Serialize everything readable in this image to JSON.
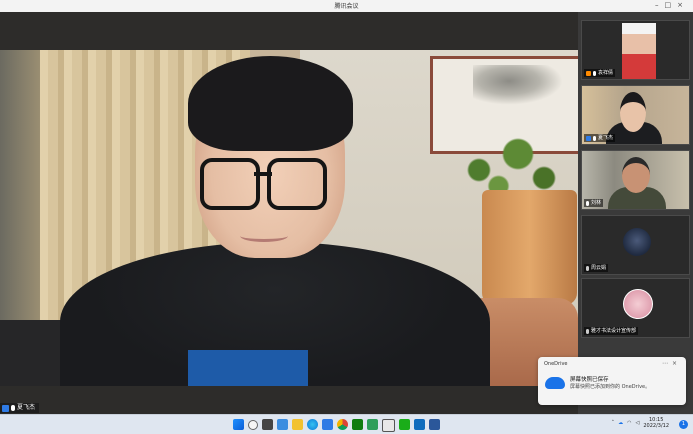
{
  "window": {
    "title": "腾讯会议"
  },
  "main_speaker": {
    "name": "夏飞杰"
  },
  "participants": [
    {
      "name": "袁祥倩"
    },
    {
      "name": "夏飞杰"
    },
    {
      "name": "刘林"
    },
    {
      "name": "周云娟"
    },
    {
      "name": "雅才书法设计宣传部"
    }
  ],
  "toast": {
    "app": "OneDrive",
    "title": "屏幕快照已保存",
    "body": "屏幕快照已添加到你的 OneDrive。",
    "icon": "onedrive-cloud-icon"
  },
  "taskbar": {
    "icons": [
      "windows-start-icon",
      "search-icon",
      "task-view-icon",
      "widgets-icon",
      "file-explorer-icon",
      "edge-icon",
      "store-icon",
      "chrome-icon",
      "xbox-icon",
      "settings-icon",
      "photos-icon",
      "wechat-icon",
      "mail-icon",
      "word-icon"
    ],
    "time": "10:15",
    "date": "2022/3/12",
    "notification_count": "1"
  },
  "colors": {
    "accent": "#1a73e8",
    "speaker_tag_bg": "#1e1e1e",
    "sidebar_bg": "#3a3a3a"
  }
}
